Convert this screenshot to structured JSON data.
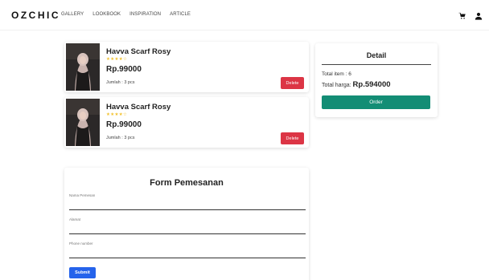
{
  "navbar": {
    "brand": "OZCHIC",
    "links": [
      "GALLERY",
      "LOOKBOOK",
      "INSPIRATION",
      "ARTICLE"
    ],
    "icons": [
      "cart-icon",
      "user-icon"
    ]
  },
  "cart": {
    "items": [
      {
        "name": "Havva Scarf Rosy",
        "stars": "★★★★☆",
        "price": "Rp.99000",
        "qty": "Jumlah : 3 pcs",
        "delete_label": "Delete"
      },
      {
        "name": "Havva Scarf Rosy",
        "stars": "★★★★☆",
        "price": "Rp.99000",
        "qty": "Jumlah : 3 pcs",
        "delete_label": "Delete"
      }
    ]
  },
  "detail": {
    "title": "Detail",
    "total_item": "Total item : 6",
    "total_harga_label": "Total harga: ",
    "total_harga_value": "Rp.594000",
    "order_label": "Order"
  },
  "form": {
    "title": "Form Pemesanan",
    "fields": [
      {
        "label": "Nama Pemesan",
        "value": ""
      },
      {
        "label": "Alamat",
        "value": ""
      },
      {
        "label": "Phone number",
        "value": ""
      }
    ],
    "submit_label": "Submit"
  },
  "colors": {
    "delete": "#dc3545",
    "order": "#138d75",
    "submit": "#2563eb",
    "stars": "#f2c230"
  }
}
